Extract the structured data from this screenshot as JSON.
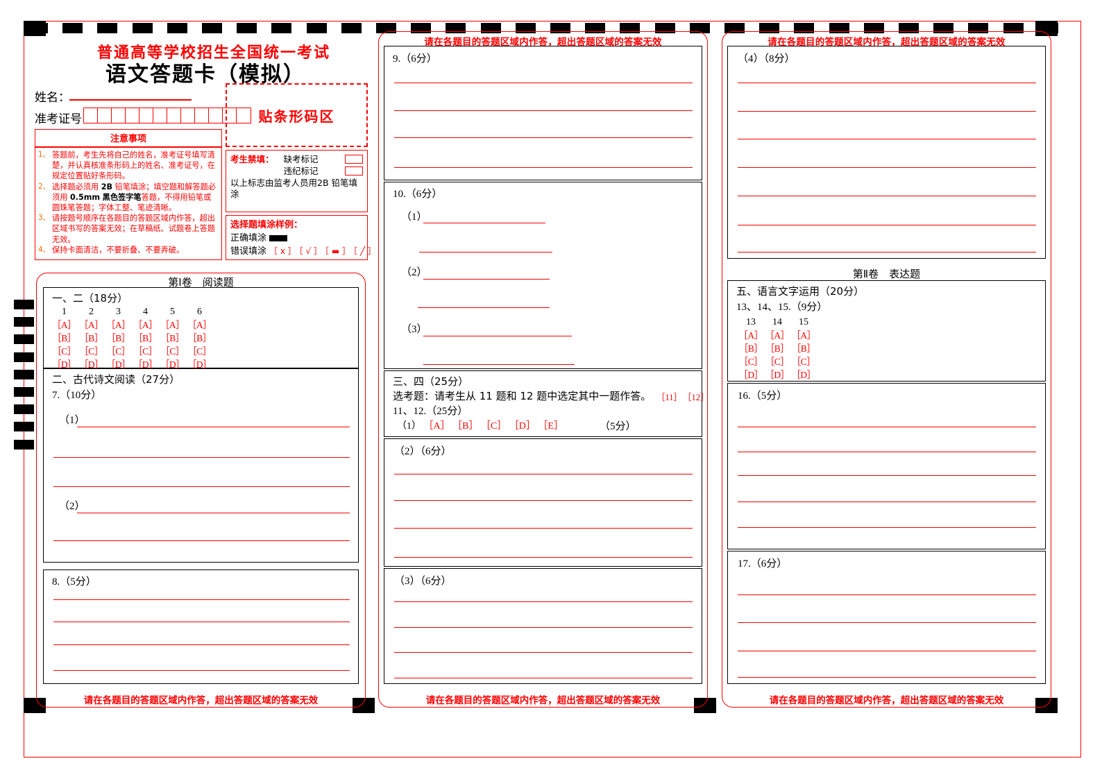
{
  "header": {
    "exam_title": "普通高等学校招生全国统一考试",
    "sheet_title": "语文答题卡（模拟）",
    "name_label": "姓名：",
    "admission_label": "准考证号：",
    "admission_digits": 12,
    "barcode_area_text": "贴条形码区"
  },
  "notes": {
    "title": "注意事项",
    "items": [
      {
        "num": "1、",
        "text": "答题前，考生先将自己的姓名，准考证号填写清楚，并认真核准条形码上的姓名、准考证号，在规定位置贴好条形码。"
      },
      {
        "num": "2、",
        "text": "选择题必须用 2B 铅笔填涂；填空题和解答题必须用 0.5mm 黑色签字笔答题，不得用铅笔或圆珠笔答题；字体工整、笔迹清晰。"
      },
      {
        "num": "3、",
        "text": "请按题号顺序在各题目的答题区域内作答，超出区域书写的答案无效；在草稿纸、试题卷上答题无效。"
      },
      {
        "num": "4、",
        "text": "保持卡面清洁，不要折叠、不要弄破。"
      }
    ]
  },
  "forbidden": {
    "key_label": "考生禁填：",
    "absent_label": "缺考标记",
    "violation_label": "违纪标记",
    "note": "以上标志由监考人员用2B 铅笔填涂"
  },
  "fill_sample": {
    "title": "选择题填涂样例：",
    "correct_label": "正确填涂",
    "wrong_label": "错误填涂",
    "wrong_marks": [
      "［ x ］",
      "［ √ ］",
      "［ ▬ ］",
      "［ ╱ ］"
    ]
  },
  "warnings": {
    "area_notice": "请在各题目的答题区域内作答，超出答题区域的答案无效"
  },
  "sections": {
    "juan1_title": "第Ⅰ卷　阅读题",
    "juan2_title": "第Ⅱ卷　表达题"
  },
  "left_column": {
    "group1": {
      "heading": "一、二（18分）",
      "numbers": [
        "1",
        "2",
        "3",
        "4",
        "5",
        "6"
      ],
      "options": [
        "［A］",
        "［B］",
        "［C］",
        "［D］"
      ]
    },
    "group2_heading": "二、古代诗文阅读（27分）",
    "q7": {
      "label": "7.（10分）",
      "sub1": "（1）",
      "sub2": "（2）"
    },
    "q8": {
      "label": "8.（5分）"
    }
  },
  "middle_column": {
    "q9": {
      "label": "9.（6分）"
    },
    "q10": {
      "label": "10.（6分）",
      "sub": [
        "（1）",
        "（2）",
        "（3）"
      ]
    },
    "group34": {
      "heading": "三、四（25分）",
      "instruction": "选考题：请考生从 11 题和 12 题中选定其中一题作答。",
      "choice_tags": [
        "［11］",
        "［12］"
      ],
      "qlabel": "11、12.（25分）",
      "sub1_prefix": "（1）",
      "sub1_options": [
        "［A］",
        "［B］",
        "［C］",
        "［D］",
        "［E］"
      ],
      "sub1_score": "（5分）"
    },
    "sub2": {
      "label": "（2）（6分）"
    },
    "sub3": {
      "label": "（3）（6分）"
    }
  },
  "right_column": {
    "sub4": {
      "label": "（4）（8分）"
    },
    "group5": {
      "heading": "五、语言文字运用（20分）",
      "qlabel": "13、14、15.（9分）",
      "numbers": [
        "13",
        "14",
        "15"
      ],
      "options": [
        "［A］",
        "［B］",
        "［C］",
        "［D］"
      ]
    },
    "q16": {
      "label": "16.（5分）"
    },
    "q17": {
      "label": "17.（6分）"
    }
  },
  "colors": {
    "red": "#ff0000",
    "black": "#000000",
    "orange": "#ff6a00"
  }
}
